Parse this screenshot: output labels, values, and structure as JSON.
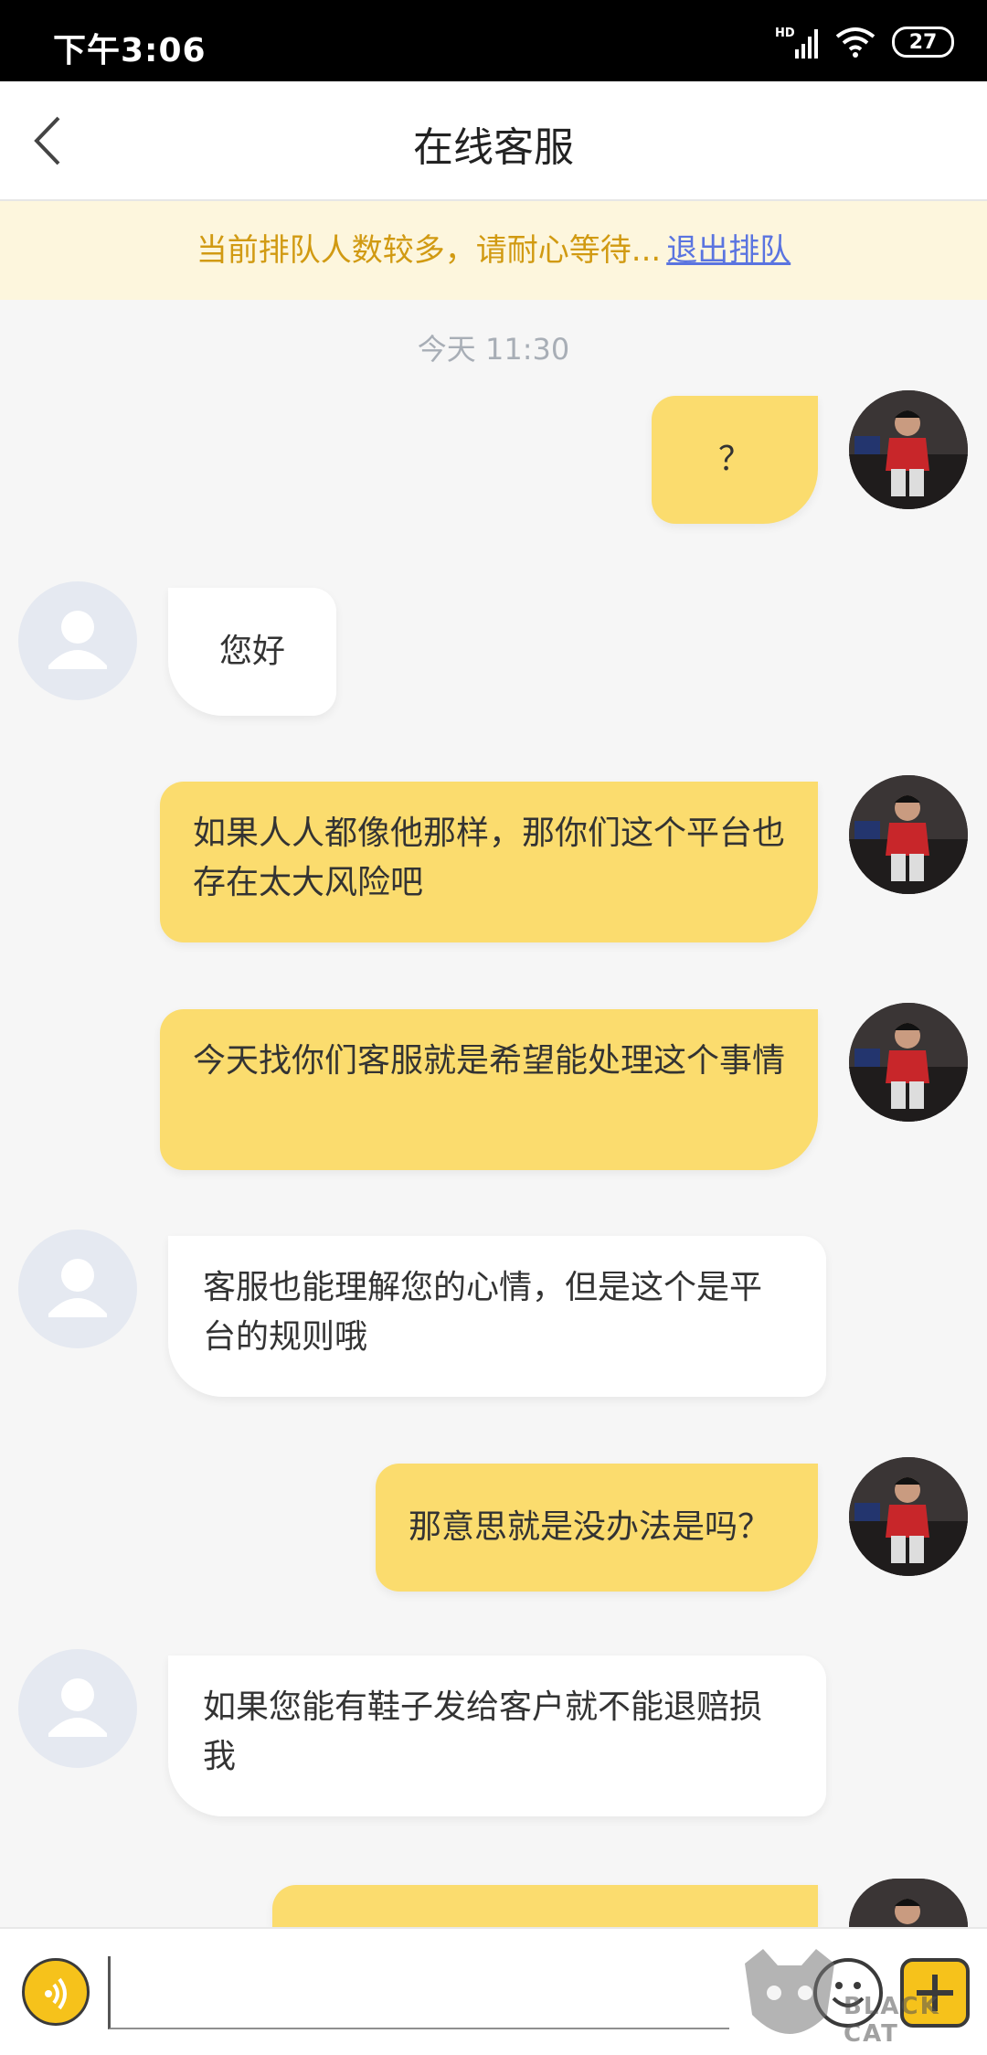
{
  "status_bar": {
    "time": "下午3:06",
    "network": "HD",
    "battery": "27"
  },
  "header": {
    "title": "在线客服"
  },
  "banner": {
    "text": "当前排队人数较多，请耐心等待...",
    "exit_label": "退出排队"
  },
  "chat": {
    "timestamp": "今天 11:30",
    "messages": [
      {
        "sender": "user",
        "text": "？"
      },
      {
        "sender": "service",
        "text": "您好"
      },
      {
        "sender": "user",
        "text": "如果人人都像他那样，那你们这个平台也存在太大风险吧"
      },
      {
        "sender": "user",
        "text": "今天找你们客服就是希望能处理这个事情"
      },
      {
        "sender": "service",
        "text": "客服也能理解您的心情，但是这个是平台的规则哦"
      },
      {
        "sender": "user",
        "text": "那意思就是没办法是吗？"
      },
      {
        "sender": "service",
        "text": "如果您能有鞋子发给客户就不能退赔损我"
      },
      {
        "sender": "user",
        "text": ""
      }
    ]
  },
  "input_bar": {
    "placeholder": ""
  },
  "watermark": {
    "text": "BLACK CAT"
  },
  "colors": {
    "user_bubble": "#fbdc6e",
    "service_bubble": "#ffffff",
    "banner_text": "#d19a12",
    "link": "#5a74e0",
    "accent": "#f6c21b"
  }
}
